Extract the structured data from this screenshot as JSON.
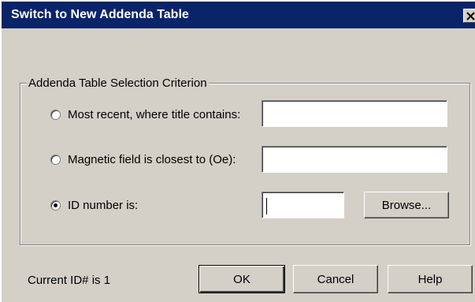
{
  "window": {
    "title": "Switch to New Addenda Table",
    "close_icon": "close-icon"
  },
  "group": {
    "legend": "Addenda Table Selection Criterion",
    "options": [
      {
        "label": "Most recent, where title contains:",
        "checked": false,
        "value": ""
      },
      {
        "label": "Magnetic field is closest to (Oe):",
        "checked": false,
        "value": ""
      },
      {
        "label": "ID number is:",
        "checked": true,
        "value": ""
      }
    ],
    "browse_label": "Browse..."
  },
  "status": {
    "current_id": "Current ID# is 1"
  },
  "buttons": {
    "ok": "OK",
    "cancel": "Cancel",
    "help": "Help"
  },
  "colors": {
    "titlebar": "#0a246a",
    "face": "#d4d0c8"
  }
}
